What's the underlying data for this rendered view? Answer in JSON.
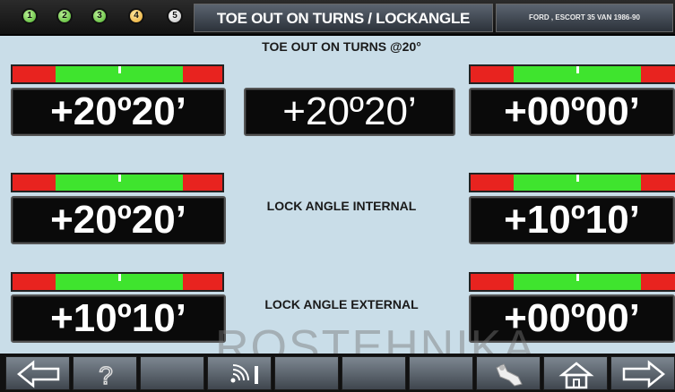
{
  "header": {
    "steps": [
      "1",
      "2",
      "3",
      "4",
      "5"
    ],
    "title": "TOE OUT ON TURNS / LOCKANGLE",
    "vehicle": "FORD , ESCORT 35 VAN 1986-90"
  },
  "main": {
    "section_toe_out": "TOE OUT ON TURNS @20°",
    "section_lock_internal": "LOCK ANGLE INTERNAL",
    "section_lock_external": "LOCK ANGLE EXTERNAL",
    "left_values": [
      "+20º20’",
      "+20º20’",
      "+10º10’"
    ],
    "center_value": "+20º20’",
    "right_values": [
      "+00º00’",
      "+10º10’",
      "+00º00’"
    ]
  },
  "watermark": "ROSTEHNIKA",
  "footer": {
    "buttons": [
      "back-arrow-icon",
      "help-icon",
      "blank",
      "signal-icon",
      "blank",
      "blank",
      "blank",
      "wrench-icon",
      "home-icon",
      "forward-arrow-icon"
    ]
  },
  "colors": {
    "gauge_red": "#e8231f",
    "gauge_green": "#3fe42e",
    "background": "#c9dde8"
  }
}
